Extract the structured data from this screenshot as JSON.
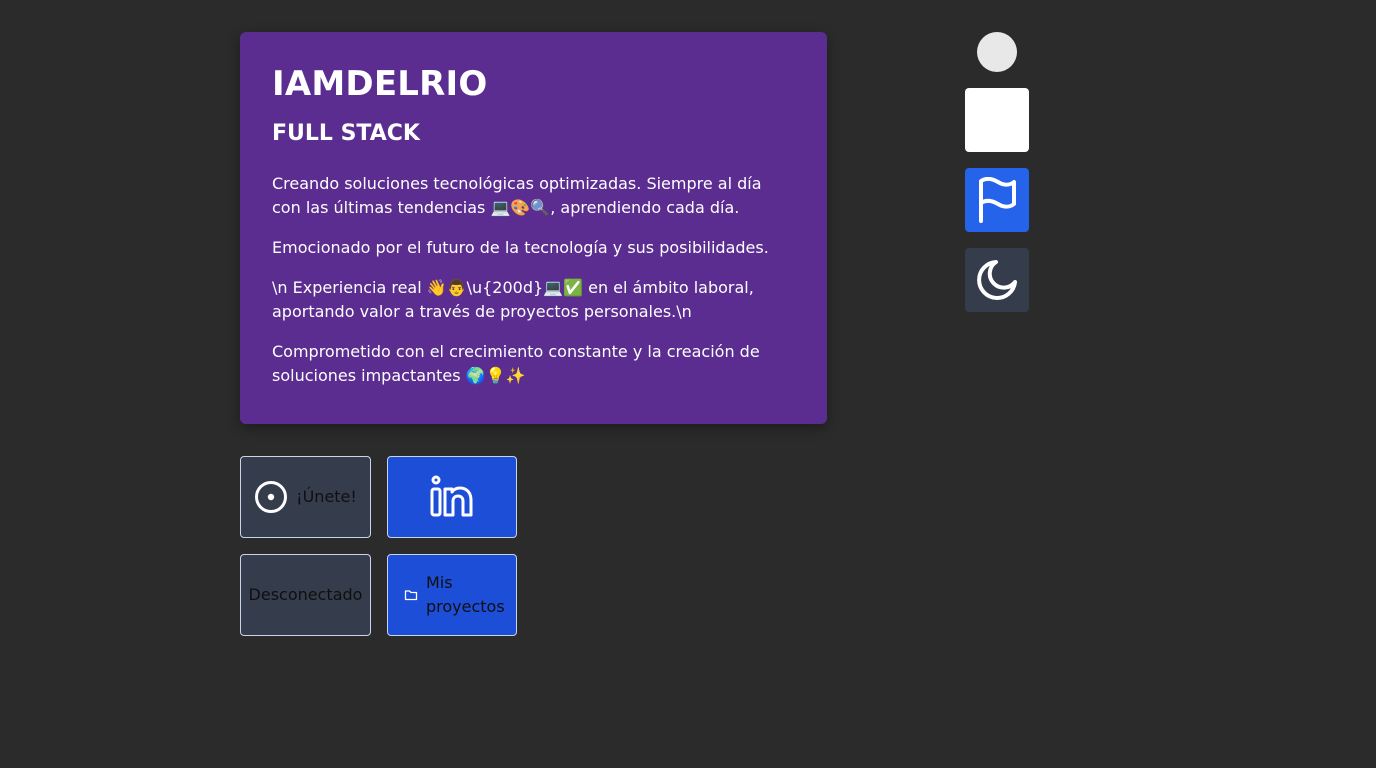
{
  "profile": {
    "name": "IAMDELRIO",
    "role": "FULL STACK",
    "paragraphs": [
      "Creando soluciones tecnológicas optimizadas. Siempre al día con las últimas tendencias 💻🎨🔍, aprendiendo cada día.",
      "Emocionado por el futuro de la tecnología y sus posibilidades.",
      "\\n Experiencia real 👋👨\\u{200d}💻✅ en el ámbito laboral, aportando valor a través de proyectos personales.\\n",
      "Comprometido con el crecimiento constante y la creación de soluciones impactantes 🌍💡✨"
    ]
  },
  "actions": {
    "join_label": "¡Únete!",
    "status_label": "Desconectado",
    "projects_label": "Mis proyectos"
  },
  "icons": {
    "join": "disc-icon",
    "linkedin": "linkedin-icon",
    "projects": "folder-icon",
    "flag": "flag-icon",
    "theme": "moon-icon"
  },
  "colors": {
    "background": "#2b2b2b",
    "card": "#5b2d91",
    "slate": "#353d4d",
    "blue": "#1d4ed8",
    "flag_button": "#2563eb"
  }
}
